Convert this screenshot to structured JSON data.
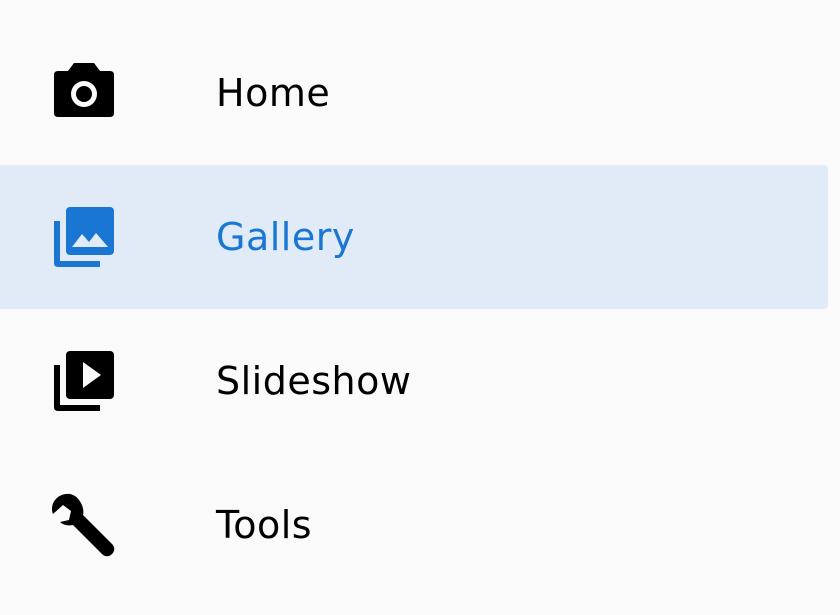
{
  "nav": {
    "items": [
      {
        "label": "Home",
        "icon": "camera-icon",
        "selected": false
      },
      {
        "label": "Gallery",
        "icon": "photo-library-icon",
        "selected": true
      },
      {
        "label": "Slideshow",
        "icon": "video-library-icon",
        "selected": false
      },
      {
        "label": "Tools",
        "icon": "wrench-icon",
        "selected": false
      }
    ]
  },
  "colors": {
    "background": "#fafafa",
    "selected_background": "#e1ebf7",
    "accent": "#1976d2",
    "text": "#000000"
  }
}
